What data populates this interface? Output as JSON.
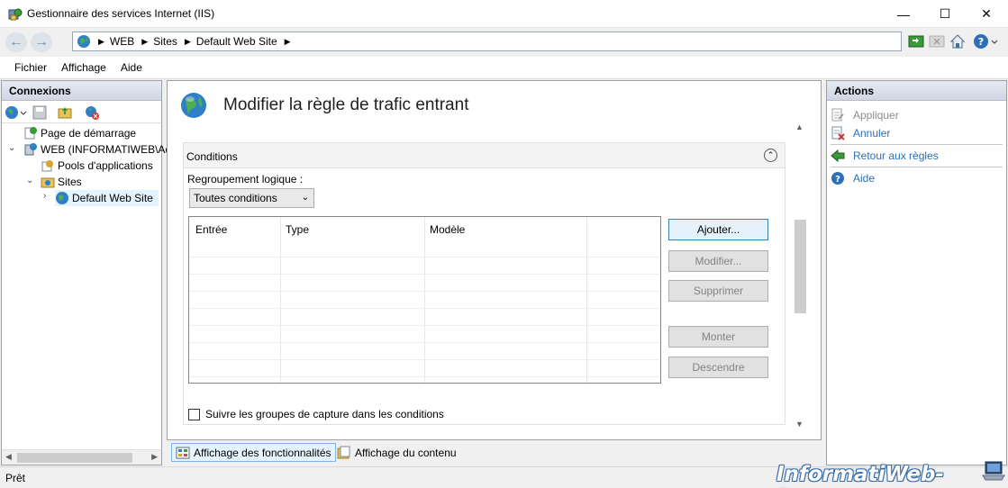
{
  "window": {
    "title": "Gestionnaire des services Internet (IIS)",
    "minimize": "—",
    "maximize": "☐",
    "close": "✕"
  },
  "address": {
    "back": "←",
    "forward": "→",
    "separator": "▶",
    "crumbs": [
      "WEB",
      "Sites",
      "Default Web Site"
    ]
  },
  "menu": {
    "items": [
      "Fichier",
      "Affichage",
      "Aide"
    ]
  },
  "connections": {
    "header": "Connexions",
    "tree": {
      "start_page": "Page de démarrage",
      "server": "WEB (INFORMATIWEB\\Ad",
      "app_pools": "Pools d'applications",
      "sites": "Sites",
      "default_site": "Default Web Site"
    }
  },
  "main": {
    "title": "Modifier la règle de trafic entrant",
    "section_title": "Conditions",
    "collapse_glyph": "⌃",
    "logical_grouping_label": "Regroupement logique :",
    "logical_grouping_value": "Toutes conditions",
    "select_chevron": "⌄",
    "table": {
      "columns": [
        "Entrée",
        "Type",
        "Modèle"
      ],
      "rows": []
    },
    "buttons": {
      "add": "Ajouter...",
      "edit": "Modifier...",
      "remove": "Supprimer",
      "move_up": "Monter",
      "move_down": "Descendre"
    },
    "checkbox_label": "Suivre les groupes de capture dans les conditions",
    "scroll_up": "▲",
    "scroll_down": "▼"
  },
  "views": {
    "features": "Affichage des fonctionnalités",
    "content": "Affichage du contenu"
  },
  "actions": {
    "header": "Actions",
    "apply": "Appliquer",
    "cancel": "Annuler",
    "back_to_rules": "Retour aux règles",
    "help": "Aide"
  },
  "status": {
    "text": "Prêt"
  },
  "watermark": "InformatiWeb-Pro.net",
  "colors": {
    "link": "#2a6fb7",
    "panel_header": "#d6dbe9",
    "selection": "#e5f3ff"
  }
}
